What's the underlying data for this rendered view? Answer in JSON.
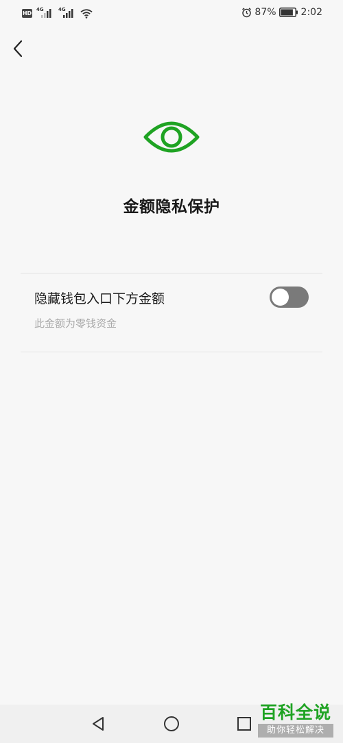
{
  "status_bar": {
    "hd_badge": "HD",
    "network_1": "4G",
    "network_2": "4G",
    "battery_percent": "87%",
    "time": "2:02",
    "battery_level": 0.87
  },
  "page": {
    "title": "金额隐私保护"
  },
  "setting": {
    "label": "隐藏钱包入口下方金额",
    "description": "此金额为零钱资金",
    "toggle_on": false
  },
  "watermark": {
    "title": "百科全说",
    "subtitle": "助你轻松解决"
  },
  "colors": {
    "accent_green": "#1fa323",
    "toggle_off": "#7a7a7a",
    "background": "#f7f7f7"
  },
  "icons": {
    "back": "chevron-left-icon",
    "eye": "eye-icon",
    "nav_back": "triangle-back-icon",
    "nav_home": "circle-home-icon",
    "nav_recent": "square-recent-icon"
  }
}
